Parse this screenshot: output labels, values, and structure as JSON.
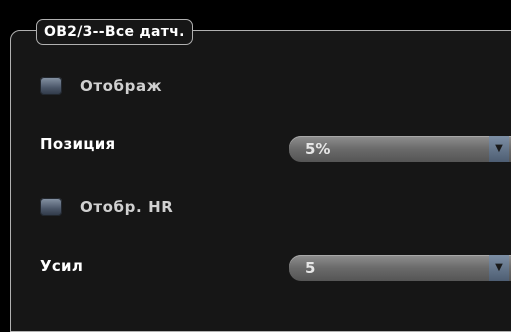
{
  "panel": {
    "title": "OB2/3--Все датч.",
    "display_checkbox": {
      "label": "Отображ",
      "checked": false
    },
    "position_field": {
      "label": "Позиция",
      "value": "5%"
    },
    "hr_checkbox": {
      "label": "Отобр. HR",
      "checked": false
    },
    "gain_field": {
      "label": "Усил",
      "value": "5"
    }
  },
  "icons": {
    "dropdown": "chevron-down-icon"
  }
}
